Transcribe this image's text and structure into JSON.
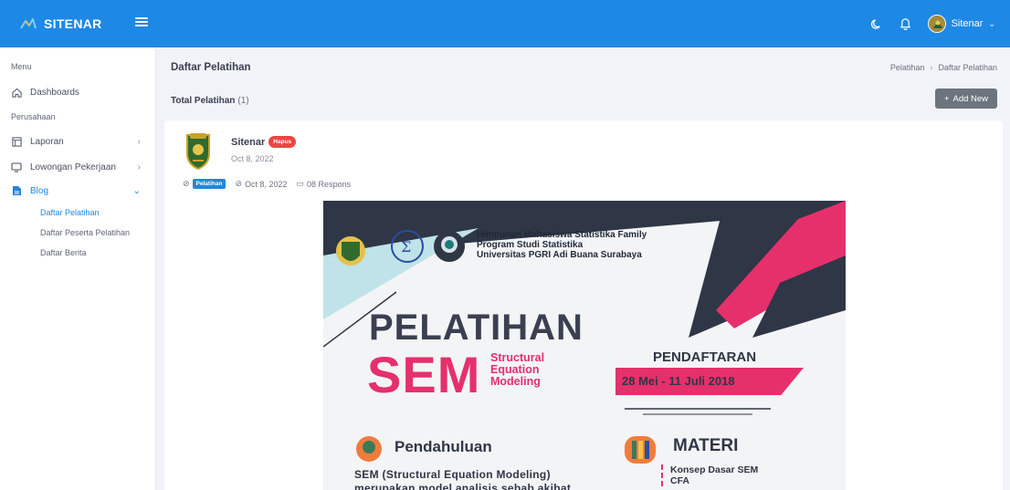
{
  "topbar": {
    "brand": "SITENAR",
    "user_name": "Sitenar",
    "accent": "#1e88e5"
  },
  "sidebar": {
    "menu_heading": "Menu",
    "dashboards": "Dashboards",
    "company_heading": "Perusahaan",
    "items": [
      {
        "label": "Laporan",
        "icon": "report-icon"
      },
      {
        "label": "Lowongan Pekerjaan",
        "icon": "monitor-icon"
      },
      {
        "label": "Blog",
        "icon": "document-icon"
      }
    ],
    "blog_sub": [
      "Daftar Pelatihan",
      "Daftar Peserta Pelatihan",
      "Daftar Berita"
    ]
  },
  "header": {
    "title": "Daftar Pelatihan",
    "breadcrumb": [
      "Pelatihan",
      "Daftar Pelatihan"
    ],
    "total_label": "Total Pelatihan",
    "total_count": "(1)",
    "add_button": "Add New"
  },
  "post": {
    "author": "Sitenar",
    "delete_badge": "Hapus",
    "date": "Oct 8, 2022",
    "tag": "Pelatihan",
    "meta_date": "Oct 8, 2022",
    "responses": "08 Respons"
  },
  "poster": {
    "org_line1": "Himpunan Mahasiswa Statistika Family",
    "org_line2": "Program Studi Statistika",
    "org_line3": "Universitas PGRI Adi Buana Surabaya",
    "title": "PELATIHAN",
    "sem": "SEM",
    "sem_sub1": "Structural",
    "sem_sub2": "Equation",
    "sem_sub3": "Modeling",
    "pendaftaran": "PENDAFTARAN",
    "dates": "28 Mei - 11 Juli 2018",
    "pendahuluan": "Pendahuluan",
    "materi": "MATERI",
    "pend_text1": "SEM (Structural Equation Modeling)",
    "pend_text2": "merupakan model analisis sebab akibat",
    "materi_1": "Konsep Dasar SEM",
    "materi_2": "CFA"
  }
}
